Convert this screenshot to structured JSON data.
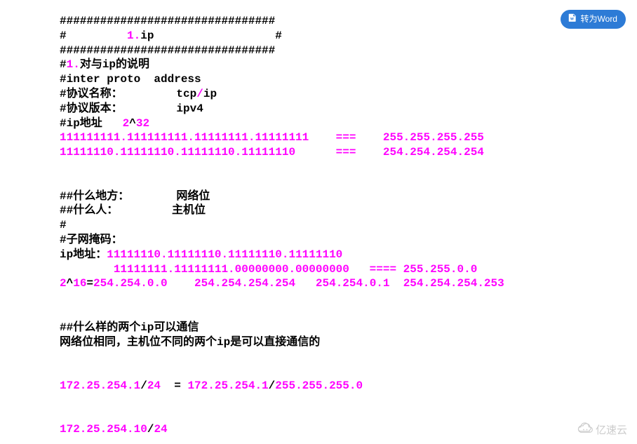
{
  "convert_button": {
    "label": "转为Word"
  },
  "watermark": {
    "text": "亿速云"
  },
  "lines": {
    "l1": {
      "a": "################################"
    },
    "l2": {
      "a": "#         ",
      "b": "1.",
      "c": "ip",
      "d": "                  #"
    },
    "l3": {
      "a": "################################"
    },
    "l4": {
      "a": "#",
      "b": "1.",
      "c": "对与ip的说明"
    },
    "l5": {
      "a": "#inter proto  address"
    },
    "l6": {
      "a": "#协议名称：        tcp",
      "b": "/",
      "c": "ip"
    },
    "l7": {
      "a": "#协议版本：        ipv4"
    },
    "l8": {
      "a": "#ip地址   ",
      "b": "2",
      "c": "^",
      "d": "32"
    },
    "l9": {
      "a": "111111111.111111111.11111111.11111111    ===    255.255.255.255"
    },
    "l10": {
      "a": "11111110.11111110.11111110.11111110      ===    254.254.254.254"
    },
    "l11": {
      "a": "",
      "b": ""
    },
    "l12": {
      "a": "",
      "b": ""
    },
    "l13": {
      "a": "##什么地方：       网络位"
    },
    "l14": {
      "a": "##什么人：        主机位"
    },
    "l15": {
      "a": "#"
    },
    "l16": {
      "a": "#子网掩码："
    },
    "l17": {
      "a": "ip地址：",
      "b": "11111110.11111110.11111110.11111110"
    },
    "l18": {
      "a": "        11111111.11111111.00000000.00000000   ==== 255.255.0.0"
    },
    "l19": {
      "a": "2",
      "b": "^",
      "c": "16",
      "d": "=",
      "e": "254.254.0.0    254.254.254.254   254.254.0.1  254.254.254.253"
    },
    "l20": {
      "a": ""
    },
    "l21": {
      "a": ""
    },
    "l22": {
      "a": "##什么样的两个ip可以通信"
    },
    "l23": {
      "a": "网络位相同，主机位不同的两个ip是可以直接通信的"
    },
    "l24": {
      "a": ""
    },
    "l25": {
      "a": ""
    },
    "l26": {
      "a": "172.25.254.1",
      "b": "/",
      "c": "24",
      "d": "  = ",
      "e": "172.25.254.1",
      "f": "/",
      "g": "255.255.255.0"
    },
    "l27": {
      "a": ""
    },
    "l28": {
      "a": ""
    },
    "l29": {
      "a": "172.25.254.10",
      "b": "/",
      "c": "24"
    }
  }
}
